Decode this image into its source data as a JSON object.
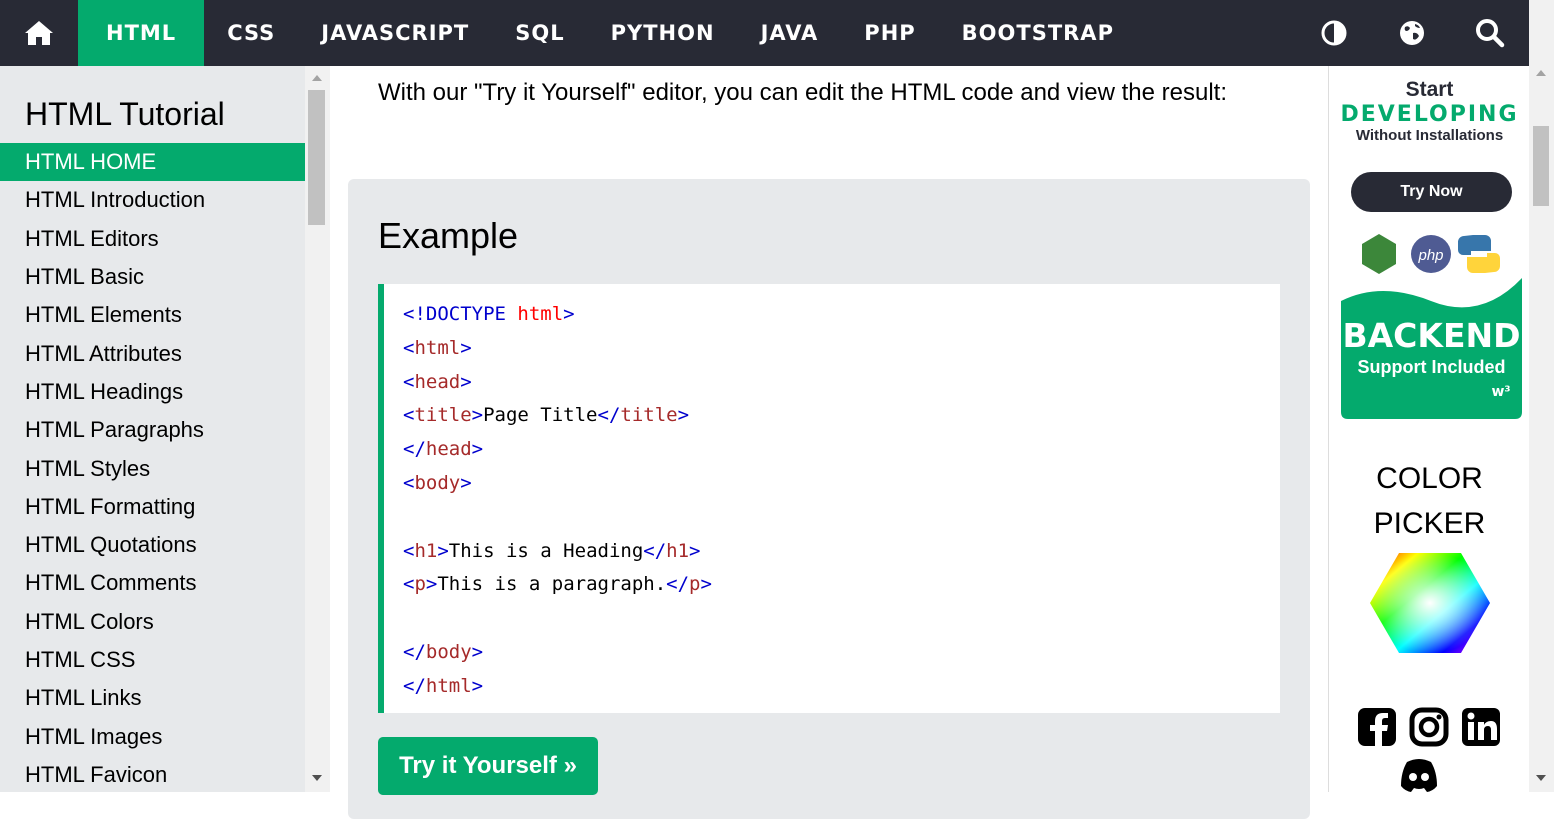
{
  "topnav": {
    "home_icon": "home-icon",
    "items": [
      {
        "label": "HTML",
        "active": true
      },
      {
        "label": "CSS"
      },
      {
        "label": "JAVASCRIPT"
      },
      {
        "label": "SQL"
      },
      {
        "label": "PYTHON"
      },
      {
        "label": "JAVA"
      },
      {
        "label": "PHP"
      },
      {
        "label": "BOOTSTRAP"
      }
    ],
    "right_icons": [
      "contrast-icon",
      "globe-icon",
      "search-icon"
    ]
  },
  "sidebar": {
    "title": "HTML Tutorial",
    "items": [
      {
        "label": "HTML HOME",
        "active": true
      },
      {
        "label": "HTML Introduction"
      },
      {
        "label": "HTML Editors"
      },
      {
        "label": "HTML Basic"
      },
      {
        "label": "HTML Elements"
      },
      {
        "label": "HTML Attributes"
      },
      {
        "label": "HTML Headings"
      },
      {
        "label": "HTML Paragraphs"
      },
      {
        "label": "HTML Styles"
      },
      {
        "label": "HTML Formatting"
      },
      {
        "label": "HTML Quotations"
      },
      {
        "label": "HTML Comments"
      },
      {
        "label": "HTML Colors"
      },
      {
        "label": "HTML CSS"
      },
      {
        "label": "HTML Links"
      },
      {
        "label": "HTML Images"
      },
      {
        "label": "HTML Favicon"
      }
    ]
  },
  "main": {
    "intro": "With our \"Try it Yourself\" editor, you can edit the HTML code and view the result:",
    "example_title": "Example",
    "code": {
      "doctype_open": "<!DOCTYPE",
      "doctype_kw": "html",
      "lt": "<",
      "gt": ">",
      "lt_slash": "</",
      "html": "html",
      "head": "head",
      "title": "title",
      "title_text": "Page Title",
      "body": "body",
      "h1": "h1",
      "h1_text": "This is a Heading",
      "p": "p",
      "p_text": "This is a paragraph."
    },
    "try_button": "Try it Yourself »"
  },
  "ads": {
    "start": "Start",
    "developing": "DEVELOPING",
    "without": "Without Installations",
    "try_now": "Try Now",
    "backend": "BACKEND",
    "support": "Support Included",
    "color_picker_line1": "COLOR",
    "color_picker_line2": "PICKER",
    "social_icons": [
      "facebook-icon",
      "instagram-icon",
      "linkedin-icon",
      "discord-icon"
    ]
  },
  "colors": {
    "nav_bg": "#282A35",
    "accent": "#04AA6D",
    "sidebar_bg": "#E7E9EB",
    "tag_color": "#0000cd",
    "tagname_color": "#a52a2a"
  }
}
